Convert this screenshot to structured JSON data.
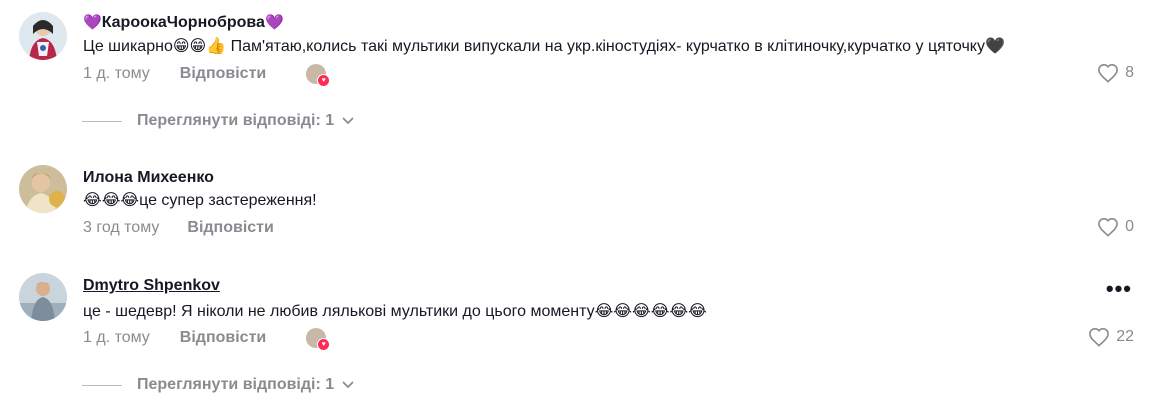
{
  "comments": [
    {
      "author": "КароокаЧорноброва",
      "author_prefix": "💜",
      "author_suffix": "💜",
      "text": "Це шикарно😁😁👍 Пам'ятаю,колись такі мультики випускали на укр.кіностудіях- курчатко в клітиночку,курчатко у цяточку🖤",
      "time": "1 д. тому",
      "reply_label": "Відповісти",
      "likes": "8",
      "view_replies": "Переглянути відповіді: 1"
    },
    {
      "author": "Илона Михеенко",
      "text": "😂😂😂це супер застереження!",
      "time": "3 год тому",
      "reply_label": "Відповісти",
      "likes": "0"
    },
    {
      "author": "Dmytro Shpenkov",
      "text": "це - шедевр! Я ніколи не любив лялькові мультики до цього моменту😂😂😂😂😂😂",
      "time": "1 д. тому",
      "reply_label": "Відповісти",
      "likes": "22",
      "more": "•••",
      "view_replies": "Переглянути відповіді: 1"
    }
  ],
  "icons": {
    "heart": "heart-outline-icon",
    "chevron": "chevron-down-icon",
    "more": "more-horizontal-icon",
    "creator_liked": "creator-liked-avatar"
  },
  "colors": {
    "text": "#161823",
    "muted": "#8a8b91",
    "badge": "#fe2c55"
  }
}
